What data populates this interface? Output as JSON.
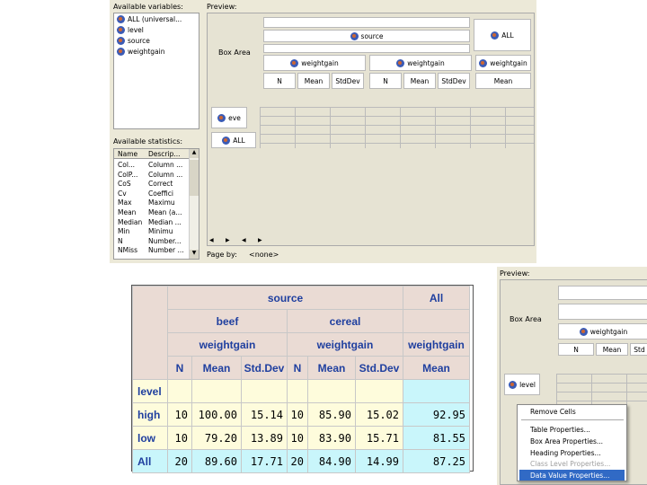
{
  "top_window": {
    "available_variables_label": "Available variables:",
    "variables": [
      "ALL (universal...",
      "level",
      "source",
      "weightgain"
    ],
    "available_statistics_label": "Available statistics:",
    "stats_col_name": "Name",
    "stats_col_desc": "Descrip...",
    "statistics": [
      {
        "name": "Col...",
        "desc": "Column ..."
      },
      {
        "name": "ColP...",
        "desc": "Column ..."
      },
      {
        "name": "CoS",
        "desc": "Correct"
      },
      {
        "name": "Cv",
        "desc": "Coeffici"
      },
      {
        "name": "Max",
        "desc": "Maximu"
      },
      {
        "name": "Mean",
        "desc": "Mean (a..."
      },
      {
        "name": "Median",
        "desc": "Median ..."
      },
      {
        "name": "Min",
        "desc": "Minimu"
      },
      {
        "name": "N",
        "desc": "Number..."
      },
      {
        "name": "NMiss",
        "desc": "Number ..."
      }
    ],
    "preview_label": "Preview:",
    "box_area_label": "Box Area",
    "source_header": "source",
    "all_header": "ALL",
    "weightgain_headers": [
      "weightgain",
      "weightgain",
      "weightgain"
    ],
    "stat_headers": [
      "N",
      "Mean",
      "StdDev",
      "N",
      "Mean",
      "StdDev",
      "Mean"
    ],
    "row_headers": [
      "eve",
      "ALL"
    ],
    "page_by_label": "Page by:",
    "page_by_value": "<none>"
  },
  "result_table": {
    "source": "source",
    "all": "All",
    "beef": "beef",
    "cereal": "cereal",
    "weightgain": [
      "weightgain",
      "weightgain",
      "weightgain"
    ],
    "stats": [
      "N",
      "Mean",
      "Std.Dev",
      "N",
      "Mean",
      "Std.Dev",
      "Mean"
    ],
    "level_label": "level",
    "rows": [
      {
        "label": "high",
        "values": [
          "10",
          "100.00",
          "15.14",
          "10",
          "85.90",
          "15.02"
        ],
        "all": "92.95"
      },
      {
        "label": "low",
        "values": [
          "10",
          "79.20",
          "13.89",
          "10",
          "83.90",
          "15.71"
        ],
        "all": "81.55"
      },
      {
        "label": "All",
        "values": [
          "20",
          "89.60",
          "17.71",
          "20",
          "84.90",
          "14.99"
        ],
        "all": "87.25"
      }
    ]
  },
  "side_window": {
    "preview_label": "Preview:",
    "box_area_label": "Box Area",
    "weightgain_header": "weightgain",
    "stat_headers": [
      "N",
      "Mean",
      "Std"
    ],
    "row_header": "level"
  },
  "context_menu": {
    "items": [
      "Remove Cells",
      "Table Properties...",
      "Box Area Properties...",
      "Heading Properties...",
      "Class Level Properties...",
      "Data Value Properties..."
    ],
    "highlight_color": "#316ac5"
  }
}
